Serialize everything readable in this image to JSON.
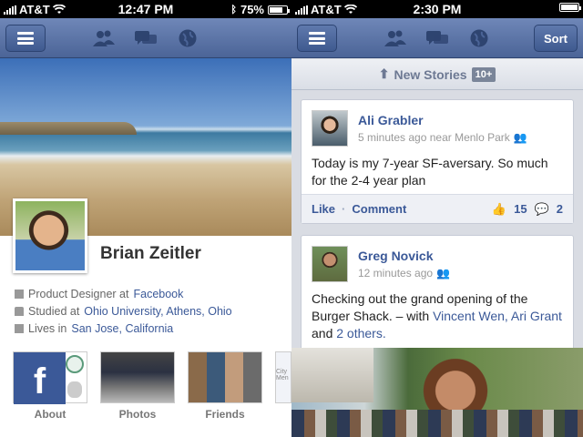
{
  "left_screen": {
    "status": {
      "carrier": "AT&T",
      "time": "12:47 PM",
      "battery": "75%",
      "battery_level": 0.75
    },
    "profile": {
      "name": "Brian Zeitler",
      "job_prefix": "Product Designer at",
      "job_link": "Facebook",
      "study_prefix": "Studied at",
      "study_link": "Ohio University, Athens, Ohio",
      "lives_prefix": "Lives in",
      "lives_link": "San Jose, California"
    },
    "tiles": [
      {
        "label": "About"
      },
      {
        "label": "Photos"
      },
      {
        "label": "Friends"
      }
    ],
    "partial_tile_text": "City Men",
    "about_tile_letter": "f"
  },
  "right_screen": {
    "status": {
      "carrier": "AT&T",
      "time": "2:30 PM"
    },
    "sort_label": "Sort",
    "new_stories": {
      "label": "New Stories",
      "count": "10+"
    },
    "posts": [
      {
        "author": "Ali Grabler",
        "meta": "5 minutes ago near Menlo Park",
        "text": "Today is my 7-year SF-aversary. So much for the 2-4 year plan",
        "like_label": "Like",
        "comment_label": "Comment",
        "likes": "15",
        "comments": "2"
      },
      {
        "author": "Greg Novick",
        "meta": "12 minutes ago",
        "text_prefix": "Checking out the grand opening of the Burger Shack. – with",
        "tag1": "Vincent Wen, Ari Grant",
        "text_mid": "and",
        "tag2": "2 others."
      }
    ]
  },
  "colors": {
    "facebook_blue": "#3b5998",
    "navbar": "#4b6497"
  },
  "icons": [
    "signal-bars-icon",
    "wifi-icon",
    "bluetooth-icon",
    "battery-icon",
    "menu-icon",
    "friend-requests-icon",
    "messages-icon",
    "notifications-globe-icon",
    "briefcase-icon",
    "graduation-icon",
    "home-icon",
    "up-arrow-icon",
    "audience-icon",
    "like-thumb-icon",
    "comment-bubble-icon"
  ]
}
